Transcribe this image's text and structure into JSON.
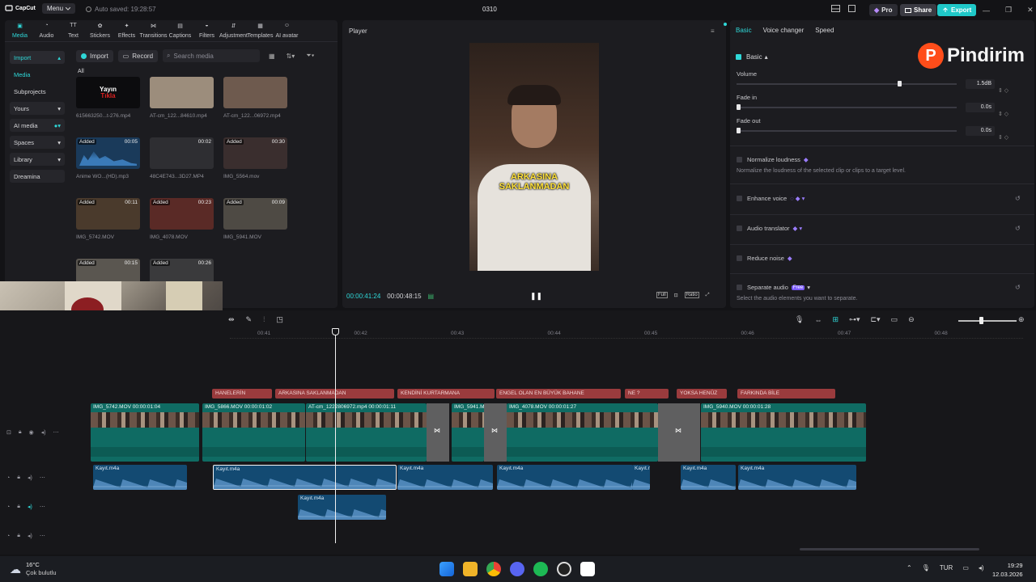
{
  "titlebar": {
    "app_name": "CapCut",
    "menu_label": "Menu",
    "autosave": "Auto saved: 19:28:57",
    "project_name": "0310",
    "pro_label": "Pro",
    "share_label": "Share",
    "export_label": "Export"
  },
  "tools": [
    "Media",
    "Audio",
    "Text",
    "Stickers",
    "Effects",
    "Transitions",
    "Captions",
    "Filters",
    "Adjustment",
    "Templates",
    "AI avatar"
  ],
  "left_nav": {
    "import": "Import",
    "media": "Media",
    "subprojects": "Subprojects",
    "yours": "Yours",
    "ai_media": "AI media",
    "spaces": "Spaces",
    "library": "Library",
    "dreamina": "Dreamina"
  },
  "media_toolbar": {
    "import_btn": "Import",
    "record_btn": "Record",
    "search_placeholder": "Search media",
    "filter_all": "All"
  },
  "media_items": [
    {
      "name": "615663250...t-276.mp4",
      "badge": "",
      "dur": ""
    },
    {
      "name": "AT-cm_122...84610.mp4",
      "badge": "",
      "dur": ""
    },
    {
      "name": "AT-cm_122...06972.mp4",
      "badge": "",
      "dur": ""
    },
    {
      "name": "Anime WO...(HD).mp3",
      "badge": "Added",
      "dur": "00:05"
    },
    {
      "name": "48C4E743...3D27.MP4",
      "badge": "",
      "dur": "00:02"
    },
    {
      "name": "IMG_5564.mov",
      "badge": "Added",
      "dur": "00:30"
    },
    {
      "name": "IMG_5742.MOV",
      "badge": "Added",
      "dur": "00:11"
    },
    {
      "name": "IMG_4078.MOV",
      "badge": "Added",
      "dur": "00:23"
    },
    {
      "name": "IMG_5941.MOV",
      "badge": "Added",
      "dur": "00:09"
    },
    {
      "name": "",
      "badge": "Added",
      "dur": "00:15"
    },
    {
      "name": "",
      "badge": "Added",
      "dur": "00:26"
    }
  ],
  "thumb_texts": {
    "t1_line1": "Yayın",
    "t1_line2": "Tıkla"
  },
  "player": {
    "title": "Player",
    "caption_line1": "ARKASINA",
    "caption_line2": "SAKLANMADAN",
    "current_time": "00:00:41:24",
    "total_time": "00:00:48:15",
    "full_label": "Full",
    "ratio_label": "Ratio"
  },
  "right_panel": {
    "tabs": [
      "Basic",
      "Voice changer",
      "Speed"
    ],
    "section": "Basic",
    "volume_label": "Volume",
    "volume_value": "1.5dB",
    "fadein_label": "Fade in",
    "fadein_value": "0.0s",
    "fadeout_label": "Fade out",
    "fadeout_value": "0.0s",
    "normalize_label": "Normalize loudness",
    "normalize_desc": "Normalize the loudness of the selected clip or clips to a target level.",
    "enhance_label": "Enhance voice",
    "translator_label": "Audio translator",
    "reduce_label": "Reduce noise",
    "separate_label": "Separate audio",
    "separate_badge": "Free",
    "separate_desc": "Select the audio elements you want to separate.",
    "volume_level": 0.74,
    "brand_overlay": "Pindirim"
  },
  "timeline": {
    "ruler": [
      "00:41",
      "00:42",
      "00:43",
      "00:44",
      "00:45",
      "00:46",
      "00:47",
      "00:48"
    ],
    "text_clips": [
      "HANELERİN",
      "ARKASINA SAKLANMADAN",
      "KENDİNİ KURTARMANA",
      "ENGEL OLAN EN BÜYÜK BAHANE",
      "NE ?",
      "YOKSA HENÜZ",
      "FARKINDA BİLE"
    ],
    "video_clips": [
      "IMG_5742.MOV   00:00:01:04",
      "IMG_5866.MOV   00:00:01:02",
      "AT-cm_1222806972.mp4   00:00:01:11",
      "IMG_5941.MOV",
      "IMG_4078.MOV   00:00:01:27",
      "IMG_5940.MOV   00:00:01:28"
    ],
    "audio_clip_label": "Kayıt.m4a",
    "audio_clip_short": "Kayıt.n"
  },
  "taskbar": {
    "temperature": "16°C",
    "weather": "Çok bulutlu",
    "lang": "TUR",
    "time": "19:29",
    "date": "12.03.2026"
  }
}
